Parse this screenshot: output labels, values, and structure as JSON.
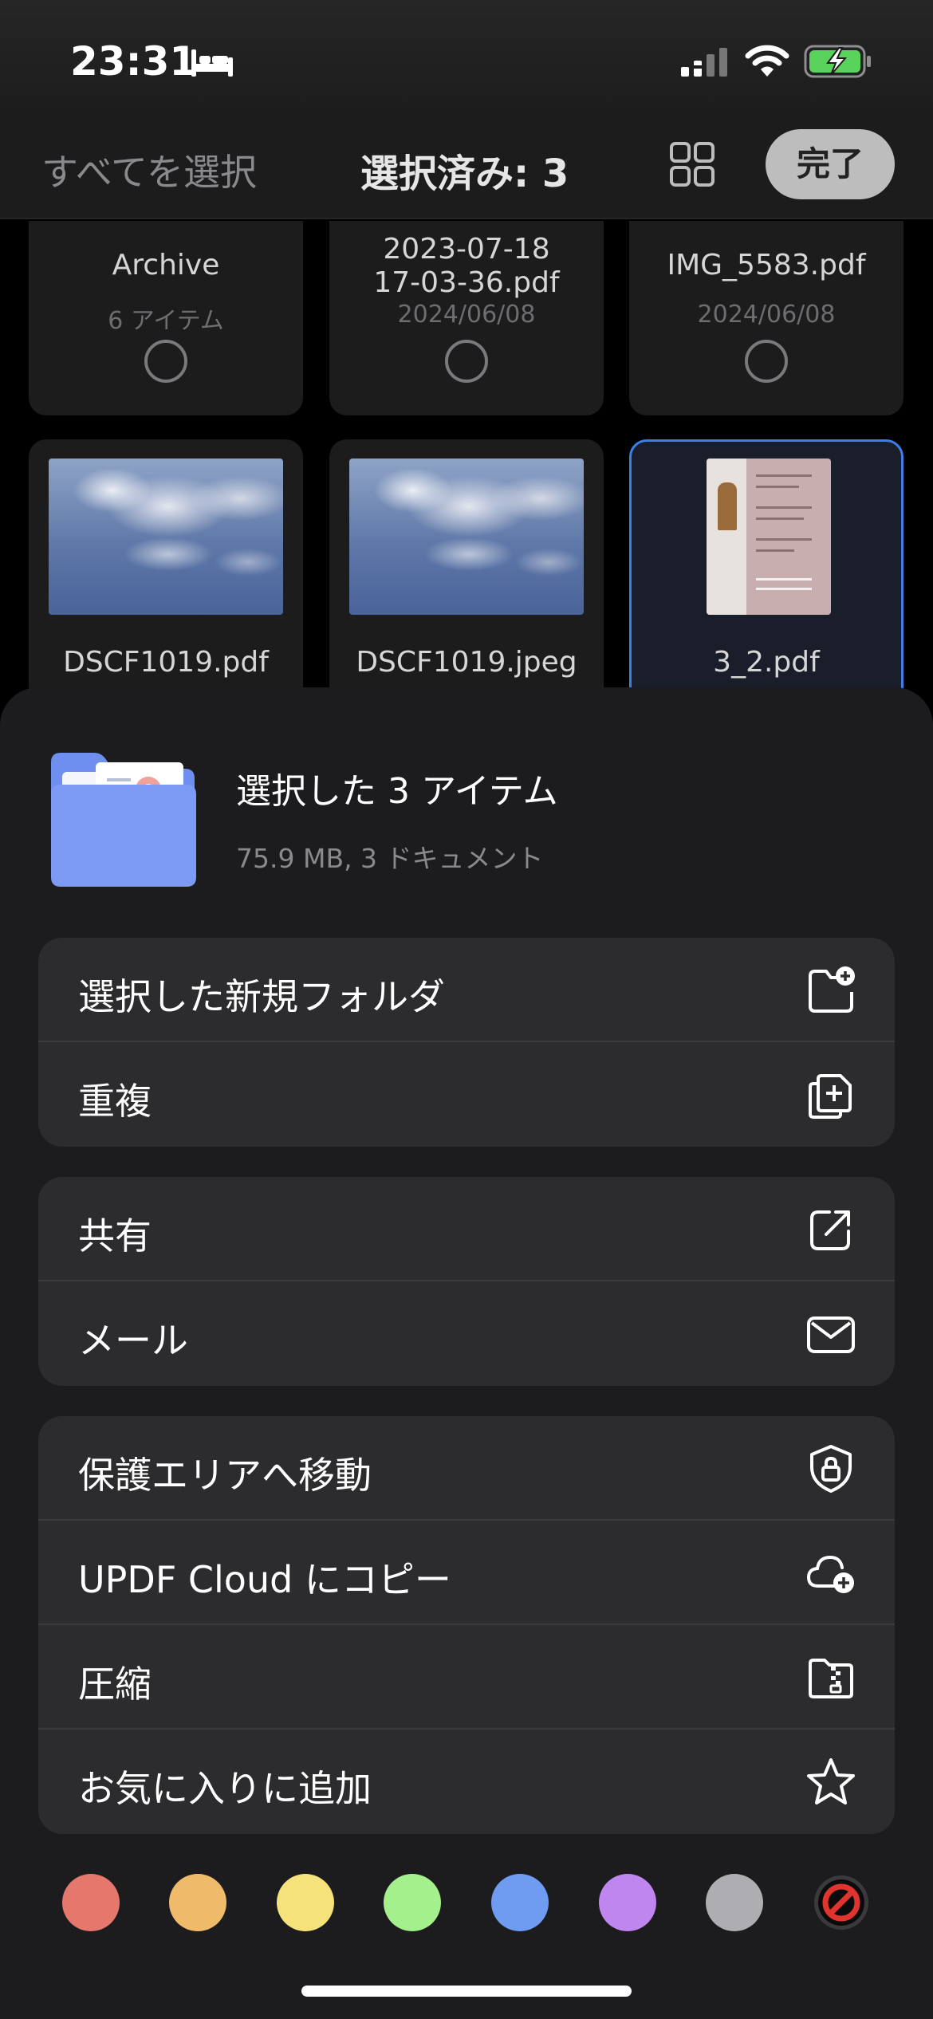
{
  "status_bar": {
    "time": "23:31"
  },
  "nav": {
    "select_all": "すべてを選択",
    "title": "選択済み: 3",
    "done": "完了"
  },
  "files": {
    "row1": [
      {
        "name": "Archive",
        "meta": "6 アイテム"
      },
      {
        "name_line1": "2023-07-18",
        "name_line2": "17-03-36.pdf",
        "meta": "2024/06/08"
      },
      {
        "name": "IMG_5583.pdf",
        "meta": "2024/06/08"
      }
    ],
    "row2": [
      {
        "name": "DSCF1019.pdf"
      },
      {
        "name": "DSCF1019.jpeg"
      },
      {
        "name": "3_2.pdf"
      }
    ]
  },
  "sheet": {
    "title": "選択した 3 アイテム",
    "subtitle": "75.9 MB, 3 ドキュメント",
    "group1": [
      {
        "label": "選択した新規フォルダ",
        "icon": "folder-plus-icon"
      },
      {
        "label": "重複",
        "icon": "duplicate-icon"
      }
    ],
    "group2": [
      {
        "label": "共有",
        "icon": "share-icon"
      },
      {
        "label": "メール",
        "icon": "mail-icon"
      }
    ],
    "group3": [
      {
        "label": "保護エリアへ移動",
        "icon": "shield-lock-icon"
      },
      {
        "label": "UPDF Cloud にコピー",
        "icon": "cloud-plus-icon"
      },
      {
        "label": "圧縮",
        "icon": "zip-folder-icon"
      },
      {
        "label": "お気に入りに追加",
        "icon": "star-icon"
      }
    ]
  },
  "color_tags": [
    "#e5776c",
    "#efbb6b",
    "#f6e27a",
    "#a4f08c",
    "#6f9cf0",
    "#bf86f0",
    "#aeaeb2"
  ],
  "colors": {
    "accent": "#3b7fe8",
    "no_color": "#e0342f"
  }
}
